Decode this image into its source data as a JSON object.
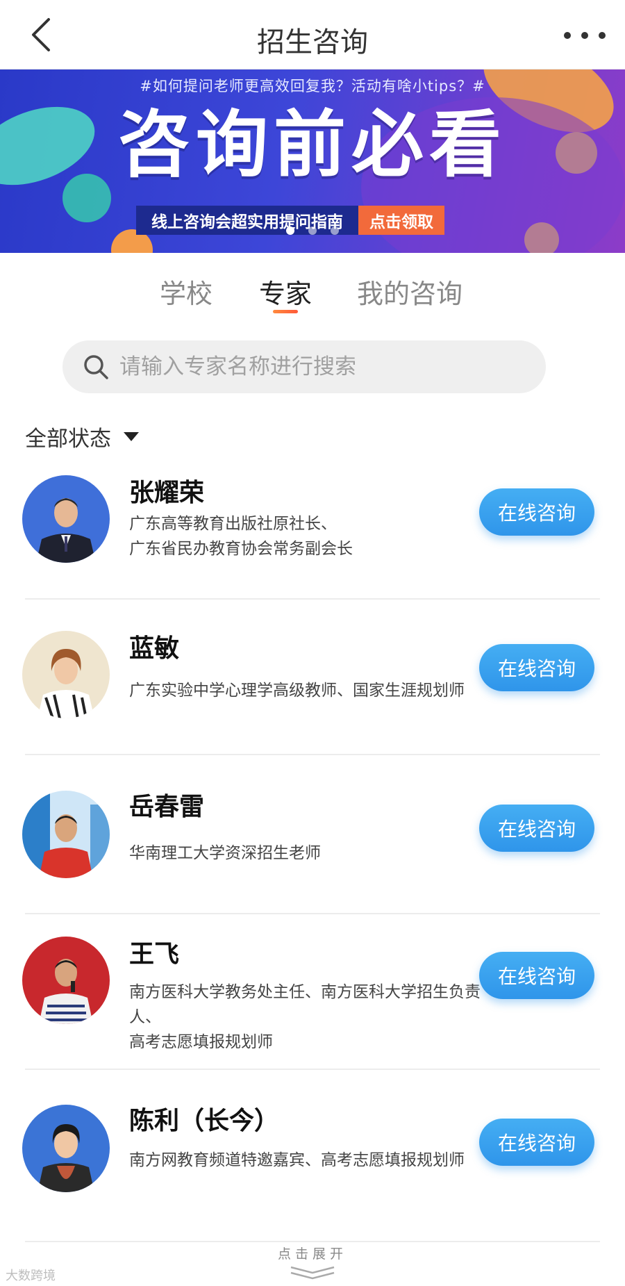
{
  "header": {
    "title": "招生咨询"
  },
  "banner": {
    "tagline": "#如何提问老师更高效回复我？活动有啥小tips？#",
    "headline": "咨询前必看",
    "subtitle": "线上咨询会超实用提问指南",
    "cta": "点击领取",
    "slides": 3,
    "active_slide": 1,
    "colors": {
      "primary": "#3d46d8",
      "cta": "#f26a3b"
    }
  },
  "tabs": [
    {
      "label": "学校",
      "active": false
    },
    {
      "label": "专家",
      "active": true
    },
    {
      "label": "我的咨询",
      "active": false
    }
  ],
  "search": {
    "placeholder": "请输入专家名称进行搜索",
    "value": ""
  },
  "filter": {
    "label": "全部状态"
  },
  "experts": [
    {
      "name": "张耀荣",
      "desc": "广东高等教育出版社原社长、\n广东省民办教育协会常务副会长",
      "button": "在线咨询"
    },
    {
      "name": "蓝敏",
      "desc": "广东实验中学心理学高级教师、国家生涯规划师",
      "button": "在线咨询"
    },
    {
      "name": "岳春雷",
      "desc": "华南理工大学资深招生老师",
      "button": "在线咨询"
    },
    {
      "name": "王飞",
      "desc": "南方医科大学教务处主任、南方医科大学招生负责人、\n高考志愿填报规划师",
      "button": "在线咨询"
    },
    {
      "name": "陈利（长今）",
      "desc": "南方网教育频道特邀嘉宾、高考志愿填报规划师",
      "button": "在线咨询"
    }
  ],
  "footer": {
    "expand_label": "点击展开",
    "watermark": "大数跨境"
  },
  "colors": {
    "accent_blue": "#2f95ea",
    "tab_underline": "#ff6a3a"
  }
}
